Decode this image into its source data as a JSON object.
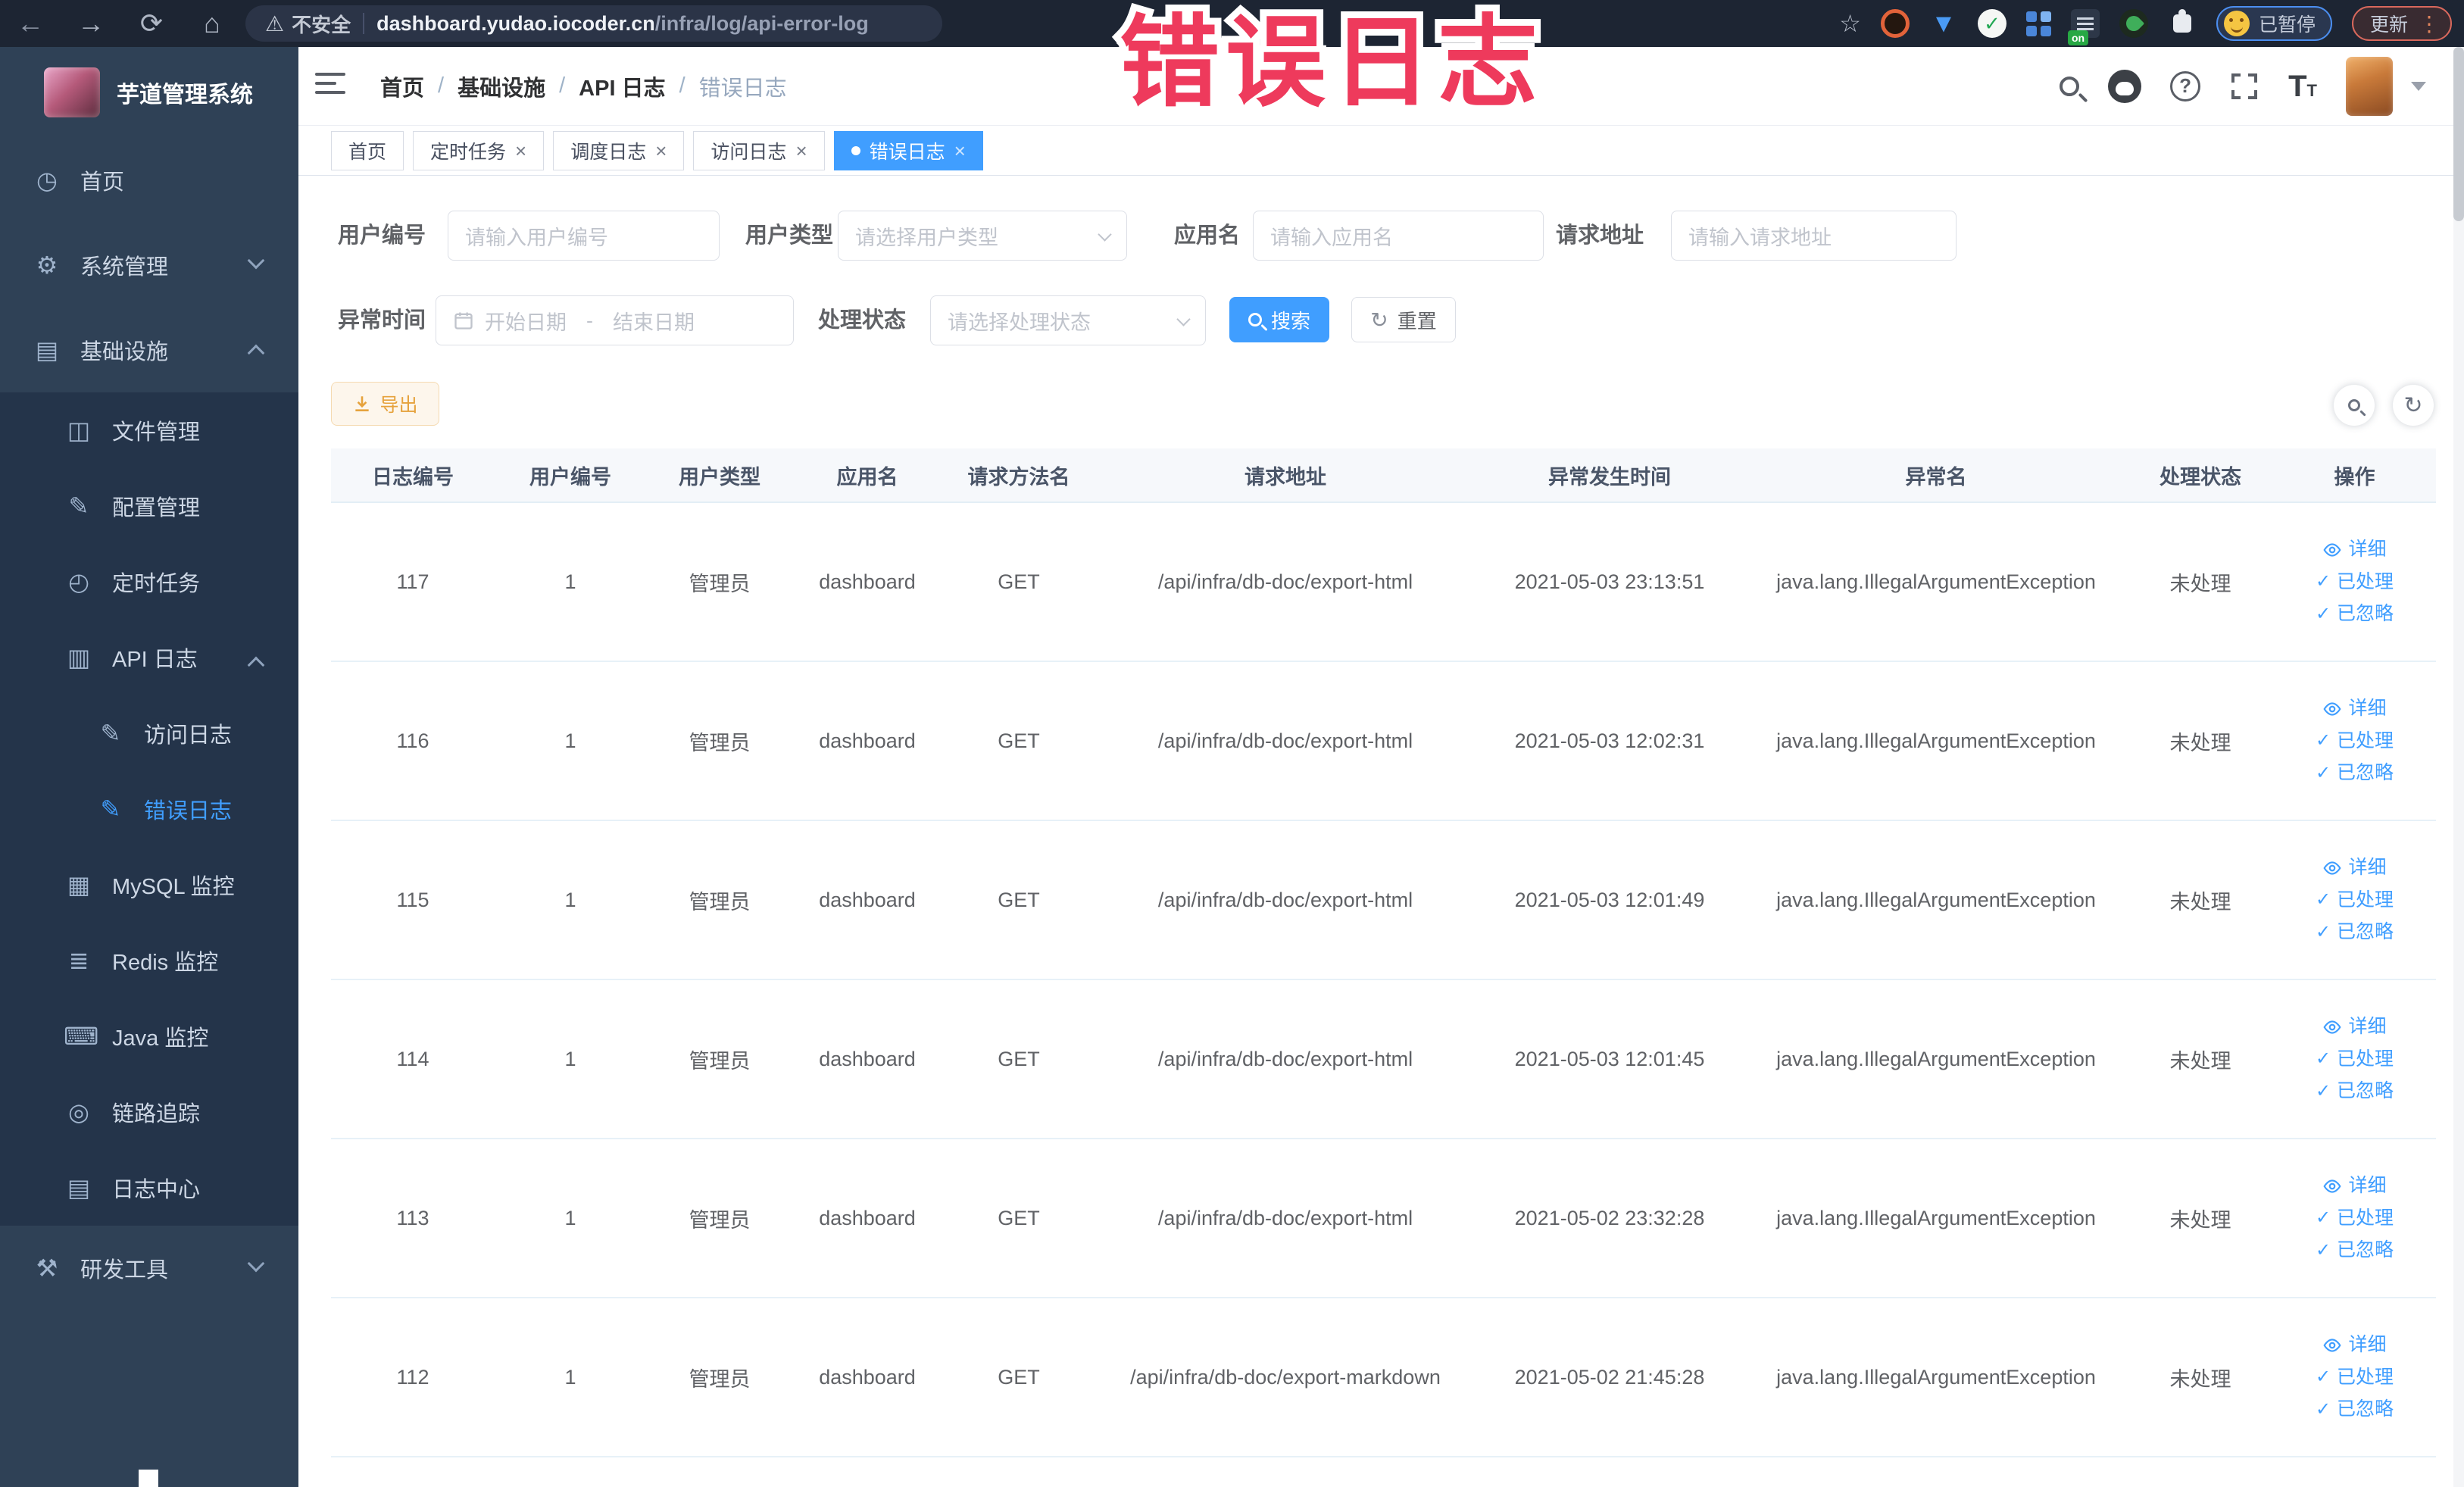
{
  "annotation": {
    "text": "错误日志",
    "color": "#ee3a5c"
  },
  "browser": {
    "security_label": "不安全",
    "url_host": "dashboard.yudao.iocoder.cn",
    "url_path": "/infra/log/api-error-log",
    "extensions_badge": "on",
    "paused_label": "已暂停",
    "update_label": "更新"
  },
  "sidebar": {
    "title": "芋道管理系统",
    "items": [
      {
        "label": "首页",
        "icon": "dashboard-icon",
        "glyph": "◷",
        "level": 0,
        "group": "main"
      },
      {
        "label": "系统管理",
        "icon": "gear-icon",
        "glyph": "⚙",
        "level": 0,
        "group": "main",
        "chevron": "down"
      },
      {
        "label": "基础设施",
        "icon": "monitor-icon",
        "glyph": "▤",
        "level": 0,
        "group": "main",
        "chevron": "up"
      },
      {
        "label": "文件管理",
        "icon": "file-manage-icon",
        "glyph": "◫",
        "level": 1,
        "group": "sub"
      },
      {
        "label": "配置管理",
        "icon": "config-edit-icon",
        "glyph": "✎",
        "level": 1,
        "group": "sub"
      },
      {
        "label": "定时任务",
        "icon": "timer-icon",
        "glyph": "◴",
        "level": 1,
        "group": "sub"
      },
      {
        "label": "API 日志",
        "icon": "api-log-icon",
        "glyph": "▥",
        "level": 1,
        "group": "sub",
        "chevron": "up"
      },
      {
        "label": "访问日志",
        "icon": "access-log-icon",
        "glyph": "✎",
        "level": 2,
        "group": "sub"
      },
      {
        "label": "错误日志",
        "icon": "error-log-icon",
        "glyph": "✎",
        "level": 2,
        "group": "sub",
        "active": true
      },
      {
        "label": "MySQL 监控",
        "icon": "mysql-monitor-icon",
        "glyph": "▦",
        "level": 1,
        "group": "sub"
      },
      {
        "label": "Redis 监控",
        "icon": "redis-monitor-icon",
        "glyph": "≣",
        "level": 1,
        "group": "sub"
      },
      {
        "label": "Java 监控",
        "icon": "java-monitor-icon",
        "glyph": "⌨",
        "level": 1,
        "group": "sub"
      },
      {
        "label": "链路追踪",
        "icon": "trace-icon",
        "glyph": "◎",
        "level": 1,
        "group": "sub"
      },
      {
        "label": "日志中心",
        "icon": "log-center-icon",
        "glyph": "▤",
        "level": 1,
        "group": "sub"
      },
      {
        "label": "研发工具",
        "icon": "dev-tools-icon",
        "glyph": "⚒",
        "level": 0,
        "group": "main",
        "chevron": "down"
      }
    ]
  },
  "header": {
    "breadcrumb": [
      "首页",
      "基础设施",
      "API 日志",
      "错误日志"
    ],
    "breadcrumb_separator": "/"
  },
  "tabs": [
    {
      "label": "首页",
      "active": false,
      "closable": false
    },
    {
      "label": "定时任务",
      "active": false,
      "closable": true
    },
    {
      "label": "调度日志",
      "active": false,
      "closable": true
    },
    {
      "label": "访问日志",
      "active": false,
      "closable": true
    },
    {
      "label": "错误日志",
      "active": true,
      "closable": true
    }
  ],
  "filters": {
    "fields": [
      {
        "label": "用户编号",
        "type": "input",
        "placeholder": "请输入用户编号"
      },
      {
        "label": "用户类型",
        "type": "select",
        "placeholder": "请选择用户类型"
      },
      {
        "label": "应用名",
        "type": "input",
        "placeholder": "请输入应用名"
      },
      {
        "label": "请求地址",
        "type": "input",
        "placeholder": "请输入请求地址"
      },
      {
        "label": "异常时间",
        "type": "daterange",
        "start_placeholder": "开始日期",
        "separator": "-",
        "end_placeholder": "结束日期"
      },
      {
        "label": "处理状态",
        "type": "select",
        "placeholder": "请选择处理状态"
      }
    ],
    "search_label": "搜索",
    "reset_label": "重置"
  },
  "toolbar": {
    "export_label": "导出"
  },
  "table": {
    "columns": [
      "日志编号",
      "用户编号",
      "用户类型",
      "应用名",
      "请求方法名",
      "请求地址",
      "异常发生时间",
      "异常名",
      "处理状态",
      "操作"
    ],
    "row_actions": [
      "详细",
      "已处理",
      "已忽略"
    ],
    "rows": [
      {
        "log_id": "117",
        "user_id": "1",
        "user_type": "管理员",
        "app_name": "dashboard",
        "method": "GET",
        "url": "/api/infra/db-doc/export-html",
        "time": "2021-05-03 23:13:51",
        "exception": "java.lang.IllegalArgumentException",
        "status": "未处理"
      },
      {
        "log_id": "116",
        "user_id": "1",
        "user_type": "管理员",
        "app_name": "dashboard",
        "method": "GET",
        "url": "/api/infra/db-doc/export-html",
        "time": "2021-05-03 12:02:31",
        "exception": "java.lang.IllegalArgumentException",
        "status": "未处理"
      },
      {
        "log_id": "115",
        "user_id": "1",
        "user_type": "管理员",
        "app_name": "dashboard",
        "method": "GET",
        "url": "/api/infra/db-doc/export-html",
        "time": "2021-05-03 12:01:49",
        "exception": "java.lang.IllegalArgumentException",
        "status": "未处理"
      },
      {
        "log_id": "114",
        "user_id": "1",
        "user_type": "管理员",
        "app_name": "dashboard",
        "method": "GET",
        "url": "/api/infra/db-doc/export-html",
        "time": "2021-05-03 12:01:45",
        "exception": "java.lang.IllegalArgumentException",
        "status": "未处理"
      },
      {
        "log_id": "113",
        "user_id": "1",
        "user_type": "管理员",
        "app_name": "dashboard",
        "method": "GET",
        "url": "/api/infra/db-doc/export-html",
        "time": "2021-05-02 23:32:28",
        "exception": "java.lang.IllegalArgumentException",
        "status": "未处理"
      },
      {
        "log_id": "112",
        "user_id": "1",
        "user_type": "管理员",
        "app_name": "dashboard",
        "method": "GET",
        "url": "/api/infra/db-doc/export-markdown",
        "time": "2021-05-02 21:45:28",
        "exception": "java.lang.IllegalArgumentException",
        "status": "未处理"
      }
    ]
  },
  "colors": {
    "accent": "#409eff",
    "annotation": "#ee3a5c",
    "export_warning": "#e6a23c",
    "sidebar_bg": "#2f4156",
    "submenu_bg": "#24344a"
  }
}
